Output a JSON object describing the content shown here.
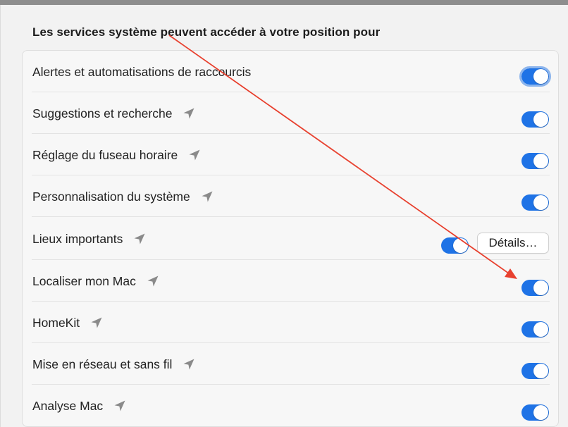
{
  "header": {
    "title": "Les services système peuvent accéder à votre position pour"
  },
  "services": [
    {
      "label": "Alertes et automatisations de raccourcis",
      "enabled": true,
      "location_icon": false
    },
    {
      "label": "Suggestions et recherche",
      "enabled": true,
      "location_icon": true
    },
    {
      "label": "Réglage du fuseau horaire",
      "enabled": true,
      "location_icon": true
    },
    {
      "label": "Personnalisation du système",
      "enabled": true,
      "location_icon": true
    },
    {
      "label": "Lieux importants",
      "enabled": true,
      "location_icon": true,
      "details_label": "Détails…"
    },
    {
      "label": "Localiser mon Mac",
      "enabled": true,
      "location_icon": true
    },
    {
      "label": "HomeKit",
      "enabled": true,
      "location_icon": true
    },
    {
      "label": "Mise en réseau et sans fil",
      "enabled": true,
      "location_icon": true
    },
    {
      "label": "Analyse Mac",
      "enabled": true,
      "location_icon": true
    }
  ],
  "colors": {
    "toggle_on": "#1f73e6",
    "annotation_arrow": "#e8412f",
    "location_icon": "#8a8a8a"
  },
  "icons": {
    "location": "location-arrow-icon"
  }
}
